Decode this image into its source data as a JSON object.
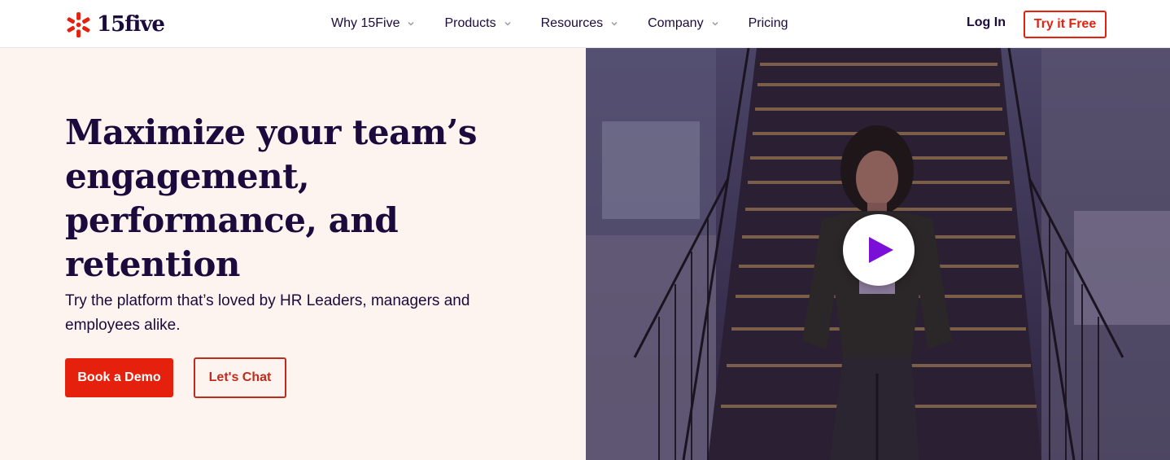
{
  "header": {
    "logo_text": "15five",
    "nav": [
      {
        "label": "Why 15Five",
        "has_dropdown": true
      },
      {
        "label": "Products",
        "has_dropdown": true
      },
      {
        "label": "Resources",
        "has_dropdown": true
      },
      {
        "label": "Company",
        "has_dropdown": true
      },
      {
        "label": "Pricing",
        "has_dropdown": false
      }
    ],
    "login_label": "Log In",
    "try_label": "Try it Free"
  },
  "hero": {
    "headline": "Maximize your team’s engagement, performance, and retention",
    "subtext": "Try the platform that’s loved by HR Leaders, managers and employees alike.",
    "primary_cta": "Book a Demo",
    "secondary_cta": "Let's Chat",
    "video_icon": "play-icon"
  },
  "colors": {
    "brand_red": "#e5210d",
    "navy_text": "#1b0a3c",
    "hero_bg": "#fdf4ef",
    "play_purple": "#7a10d8"
  }
}
